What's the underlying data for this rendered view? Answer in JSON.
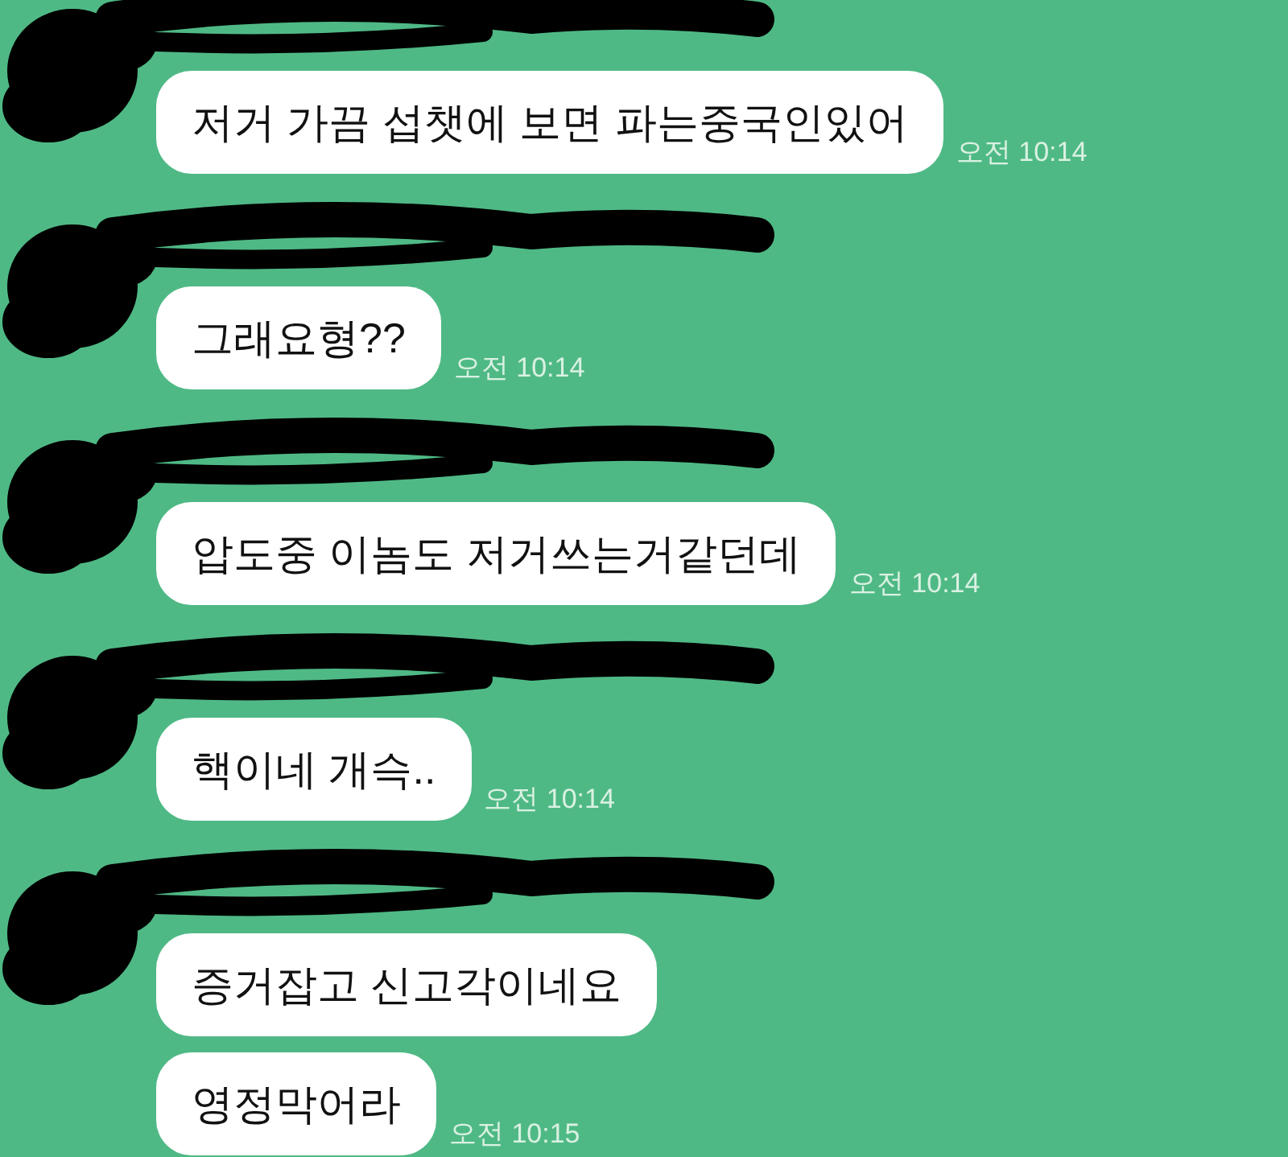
{
  "chat": {
    "groups": [
      {
        "sender_redacted": true,
        "messages": [
          {
            "text": "저거 가끔 섭챗에 보면 파는중국인있어",
            "time": "오전 10:14"
          }
        ]
      },
      {
        "sender_redacted": true,
        "messages": [
          {
            "text": "그래요형??",
            "time": "오전 10:14"
          }
        ]
      },
      {
        "sender_redacted": true,
        "messages": [
          {
            "text": "압도중 이놈도 저거쓰는거같던데",
            "time": "오전 10:14"
          }
        ]
      },
      {
        "sender_redacted": true,
        "messages": [
          {
            "text": "핵이네 개슥..",
            "time": "오전 10:14"
          }
        ]
      },
      {
        "sender_redacted": true,
        "messages": [
          {
            "text": "증거잡고 신고각이네요"
          },
          {
            "text": "영정막어라",
            "time": "오전 10:15"
          }
        ]
      }
    ]
  }
}
